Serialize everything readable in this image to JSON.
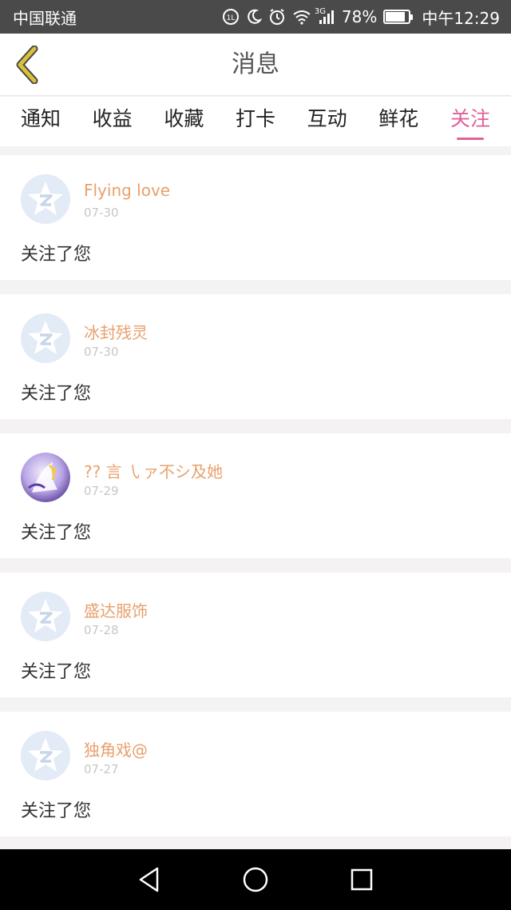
{
  "status_bar": {
    "carrier": "中国联通",
    "network": "3G",
    "battery": "78%",
    "time": "中午12:29",
    "icons": [
      "data-saver-icon",
      "moon-icon",
      "alarm-icon",
      "wifi-icon",
      "signal-icon",
      "battery-icon"
    ]
  },
  "navbar": {
    "back_icon": "chevron-left-icon",
    "title": "消息"
  },
  "tabs": [
    {
      "label": "通知",
      "active": false
    },
    {
      "label": "收益",
      "active": false
    },
    {
      "label": "收藏",
      "active": false
    },
    {
      "label": "打卡",
      "active": false
    },
    {
      "label": "互动",
      "active": false
    },
    {
      "label": "鲜花",
      "active": false
    },
    {
      "label": "关注",
      "active": true
    }
  ],
  "feed": [
    {
      "name": "Flying love",
      "date": "07-30",
      "text": "关注了您",
      "avatar": "default-star-avatar"
    },
    {
      "name": "冰封残灵",
      "date": "07-30",
      "text": "关注了您",
      "avatar": "default-star-avatar"
    },
    {
      "name": "?? 言 ㇂ァ不シ及她",
      "date": "07-29",
      "text": "关注了您",
      "avatar": "photo-avatar"
    },
    {
      "name": "盛达服饰",
      "date": "07-28",
      "text": "关注了您",
      "avatar": "default-star-avatar"
    },
    {
      "name": "独角戏@",
      "date": "07-27",
      "text": "关注了您",
      "avatar": "default-star-avatar"
    }
  ],
  "colors": {
    "accent": "#e0609a",
    "username": "#e8a06c",
    "date": "#c7c7c7",
    "back_arrow": "#d9c23a",
    "status_bar": "#4a4a4a"
  },
  "system_nav": {
    "buttons": [
      "back-triangle-icon",
      "home-circle-icon",
      "recents-square-icon"
    ]
  }
}
